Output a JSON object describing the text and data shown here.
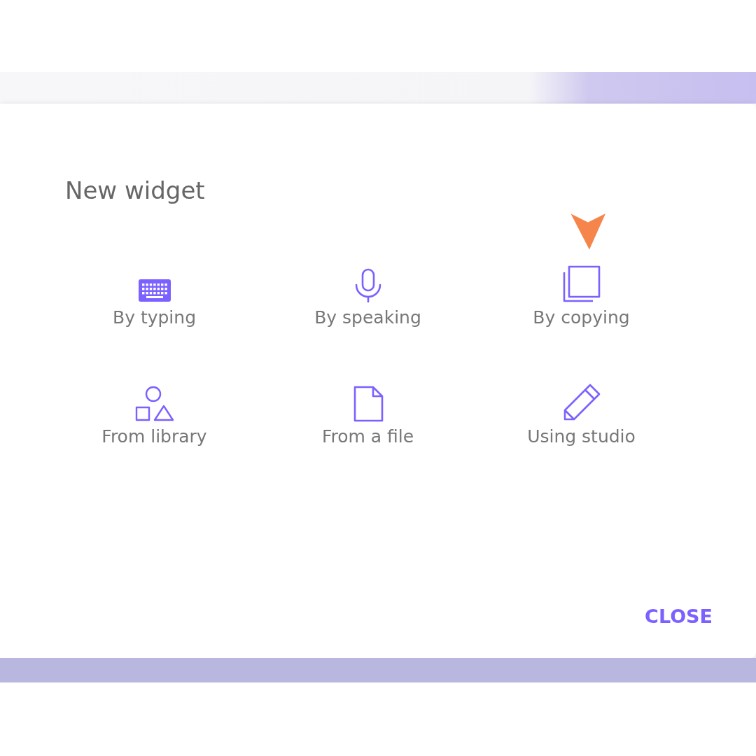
{
  "dialog": {
    "title": "New widget",
    "options": [
      {
        "label": "By typing",
        "kind": "keyboard"
      },
      {
        "label": "By speaking",
        "kind": "microphone"
      },
      {
        "label": "By copying",
        "kind": "copy"
      },
      {
        "label": "From library",
        "kind": "shapes"
      },
      {
        "label": "From a file",
        "kind": "file"
      },
      {
        "label": "Using studio",
        "kind": "pencil"
      }
    ],
    "close_button": "CLOSE"
  }
}
